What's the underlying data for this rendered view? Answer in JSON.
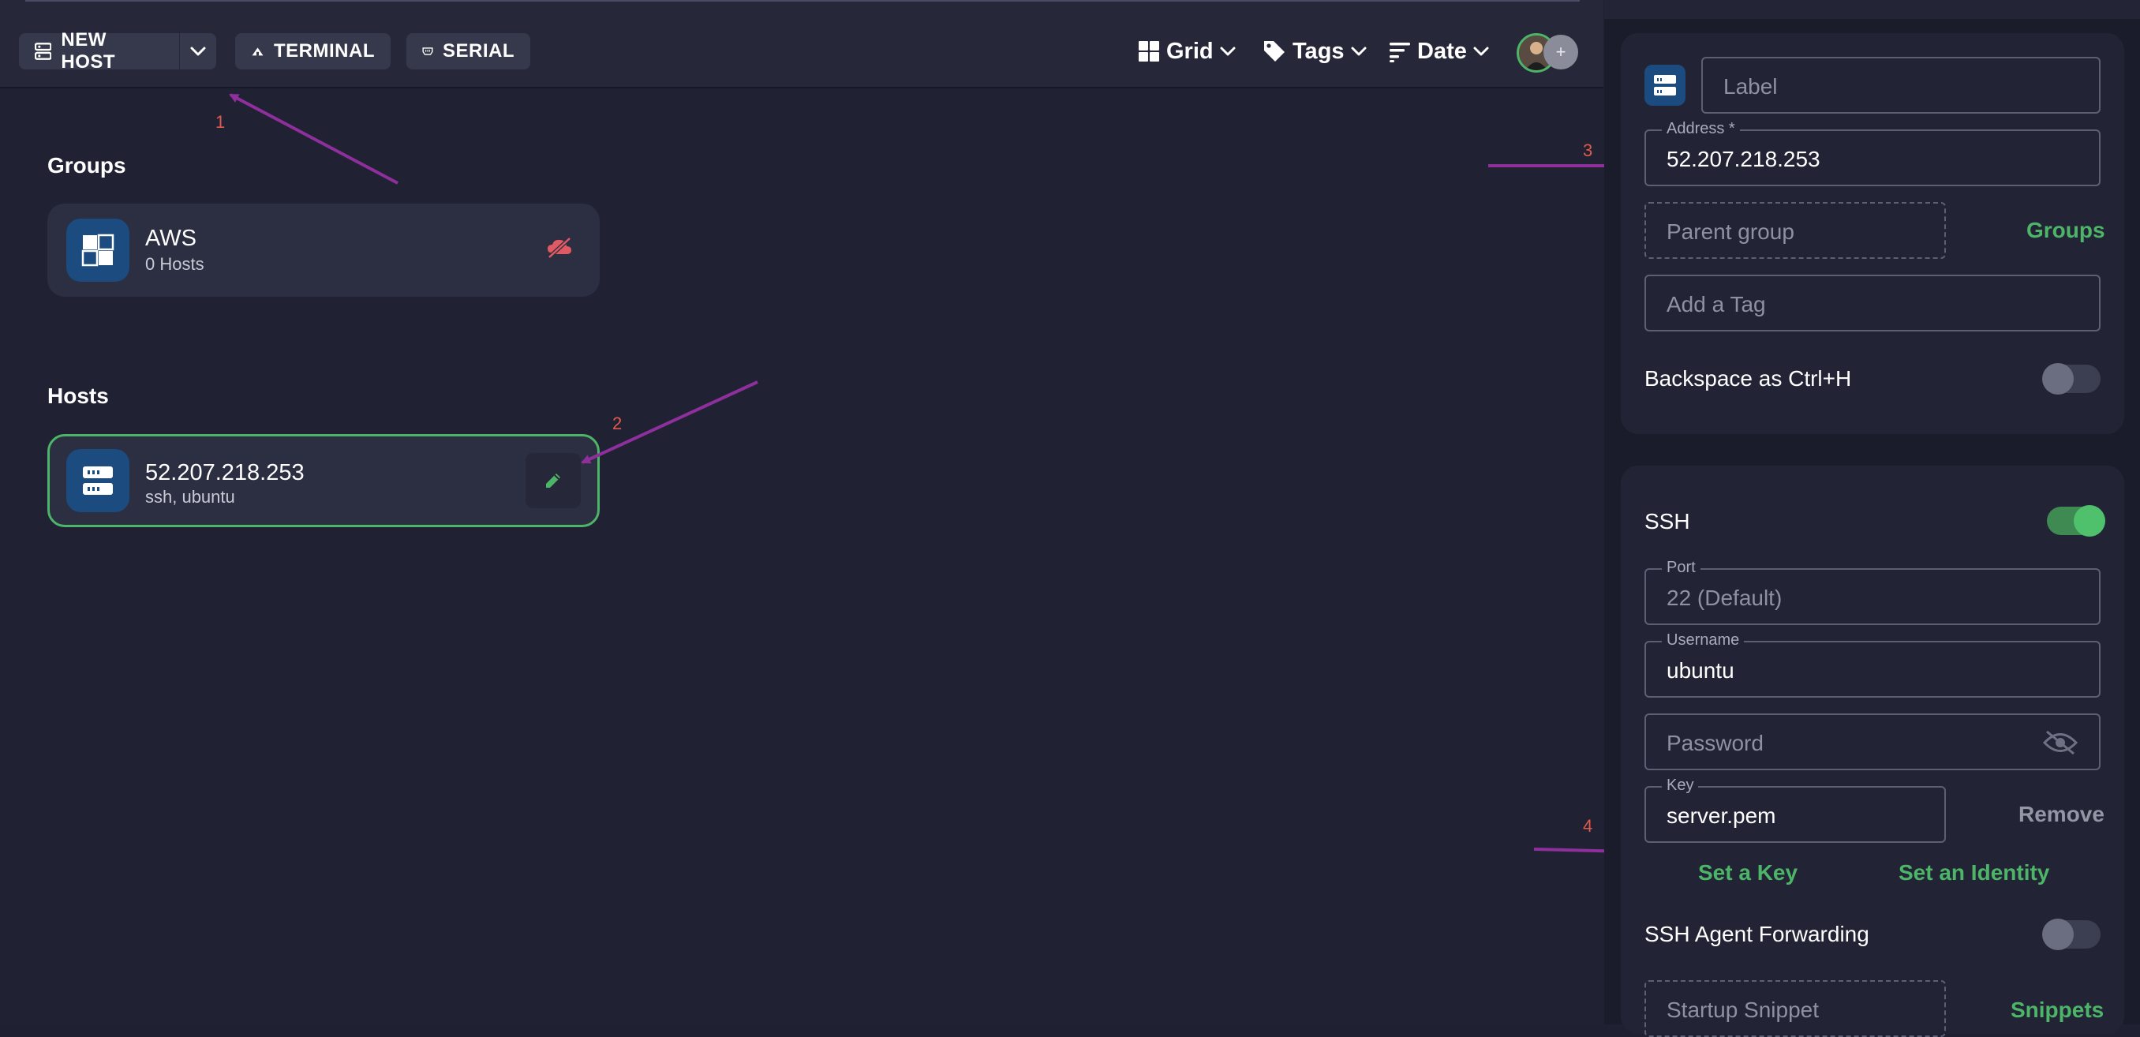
{
  "toolbar": {
    "new_host_label": "NEW HOST",
    "terminal_label": "TERMINAL",
    "serial_label": "SERIAL",
    "view_label": "Grid",
    "tags_label": "Tags",
    "sort_label": "Date",
    "avatar_plus": "+"
  },
  "groups": {
    "heading": "Groups",
    "items": [
      {
        "title": "AWS",
        "subtitle": "0 Hosts",
        "icon": "group-tiles-icon"
      }
    ]
  },
  "hosts": {
    "heading": "Hosts",
    "items": [
      {
        "title": "52.207.218.253",
        "subtitle": "ssh, ubuntu",
        "icon": "server-icon"
      }
    ]
  },
  "annotations": [
    "1",
    "2",
    "3",
    "4"
  ],
  "editor": {
    "label_placeholder": "Label",
    "address_legend": "Address *",
    "address_value": "52.207.218.253",
    "parent_group_placeholder": "Parent group",
    "groups_link": "Groups",
    "tag_placeholder": "Add a Tag",
    "backspace_label": "Backspace as Ctrl+H",
    "backspace_enabled": false,
    "ssh_label": "SSH",
    "ssh_enabled": true,
    "port_legend": "Port",
    "port_placeholder": "22 (Default)",
    "username_legend": "Username",
    "username_value": "ubuntu",
    "password_placeholder": "Password",
    "key_legend": "Key",
    "key_value": "server.pem",
    "remove_label": "Remove",
    "set_key_label": "Set a Key",
    "set_identity_label": "Set an Identity",
    "agent_forwarding_label": "SSH Agent Forwarding",
    "agent_forwarding_enabled": false,
    "startup_snippet_placeholder": "Startup Snippet",
    "snippets_link": "Snippets"
  },
  "colors": {
    "accent_green": "#4cb567",
    "annotation_arrow": "#8e2f9c",
    "annotation_number": "#e05a4b",
    "tile_blue": "#1b4b7f"
  }
}
